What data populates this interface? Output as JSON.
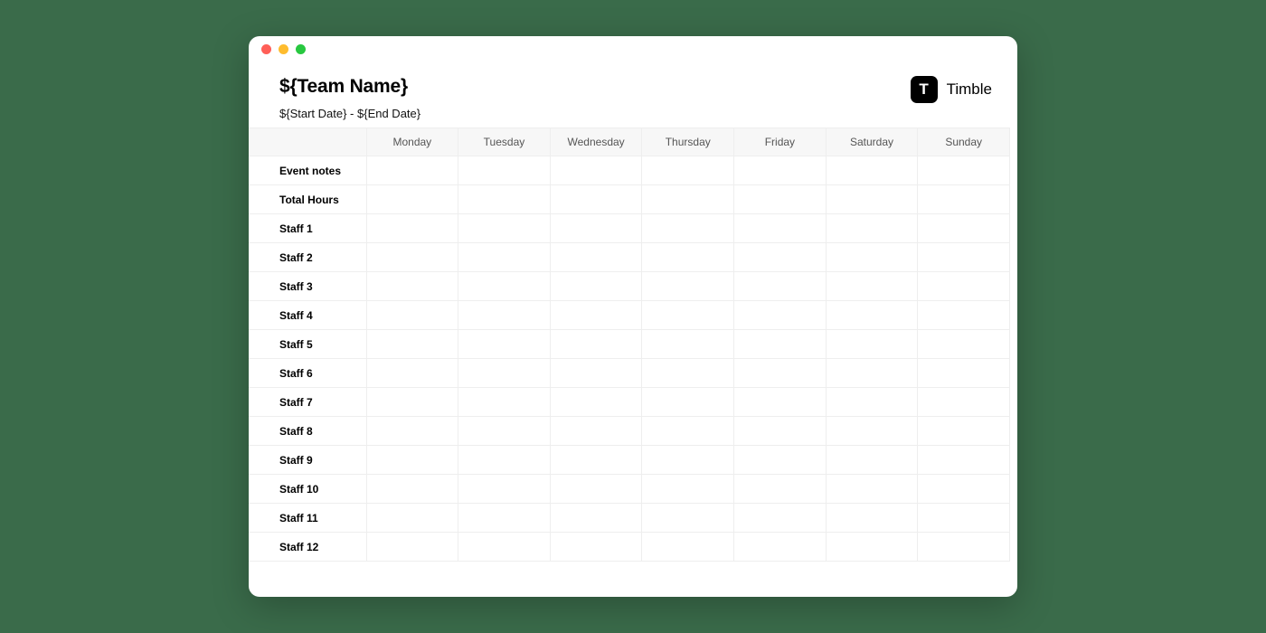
{
  "brand": {
    "logo_letter": "T",
    "name": "Timble"
  },
  "header": {
    "title": "${Team Name}",
    "date_range": "${Start Date} - ${End Date}"
  },
  "table": {
    "columns": [
      "",
      "Monday",
      "Tuesday",
      "Wednesday",
      "Thursday",
      "Friday",
      "Saturday",
      "Sunday"
    ],
    "rows": [
      {
        "label": "Event notes",
        "cells": [
          "",
          "",
          "",
          "",
          "",
          "",
          ""
        ]
      },
      {
        "label": "Total Hours",
        "cells": [
          "",
          "",
          "",
          "",
          "",
          "",
          ""
        ]
      },
      {
        "label": "Staff 1",
        "cells": [
          "",
          "",
          "",
          "",
          "",
          "",
          ""
        ]
      },
      {
        "label": "Staff 2",
        "cells": [
          "",
          "",
          "",
          "",
          "",
          "",
          ""
        ]
      },
      {
        "label": "Staff 3",
        "cells": [
          "",
          "",
          "",
          "",
          "",
          "",
          ""
        ]
      },
      {
        "label": "Staff 4",
        "cells": [
          "",
          "",
          "",
          "",
          "",
          "",
          ""
        ]
      },
      {
        "label": "Staff 5",
        "cells": [
          "",
          "",
          "",
          "",
          "",
          "",
          ""
        ]
      },
      {
        "label": "Staff 6",
        "cells": [
          "",
          "",
          "",
          "",
          "",
          "",
          ""
        ]
      },
      {
        "label": "Staff 7",
        "cells": [
          "",
          "",
          "",
          "",
          "",
          "",
          ""
        ]
      },
      {
        "label": "Staff 8",
        "cells": [
          "",
          "",
          "",
          "",
          "",
          "",
          ""
        ]
      },
      {
        "label": "Staff 9",
        "cells": [
          "",
          "",
          "",
          "",
          "",
          "",
          ""
        ]
      },
      {
        "label": "Staff 10",
        "cells": [
          "",
          "",
          "",
          "",
          "",
          "",
          ""
        ]
      },
      {
        "label": "Staff 11",
        "cells": [
          "",
          "",
          "",
          "",
          "",
          "",
          ""
        ]
      },
      {
        "label": "Staff 12",
        "cells": [
          "",
          "",
          "",
          "",
          "",
          "",
          ""
        ]
      }
    ]
  }
}
